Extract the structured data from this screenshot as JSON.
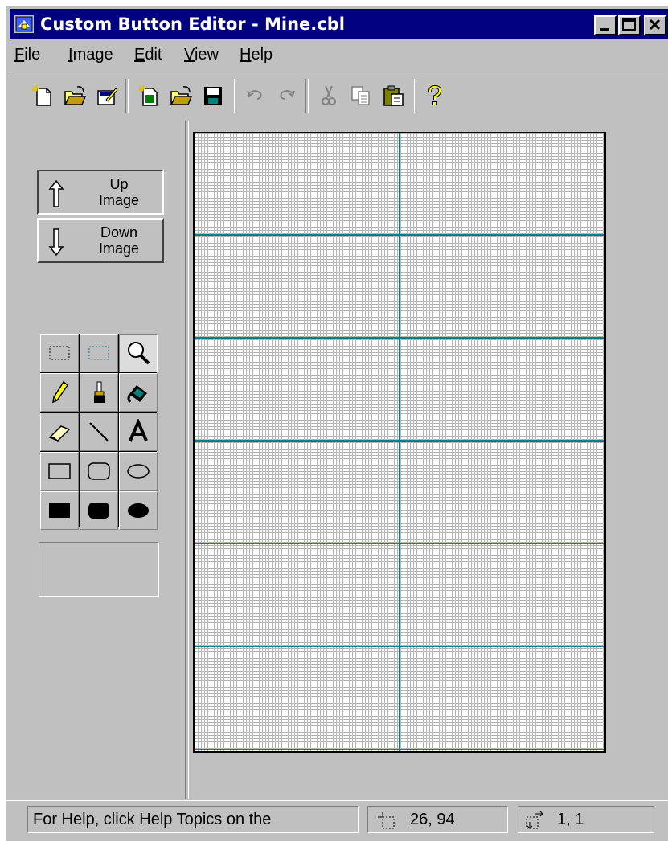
{
  "window": {
    "title": "Custom Button Editor - Mine.cbl",
    "title_bar_color": "#000080"
  },
  "menu": [
    {
      "label": "File",
      "accel": "F",
      "rest": "ile"
    },
    {
      "label": "Image",
      "accel": "I",
      "rest": "mage"
    },
    {
      "label": "Edit",
      "accel": "E",
      "rest": "dit"
    },
    {
      "label": "View",
      "accel": "V",
      "rest": "iew"
    },
    {
      "label": "Help",
      "accel": "H",
      "rest": "elp"
    }
  ],
  "toolbar_icons": [
    "new-library-icon",
    "open-library-icon",
    "edit-library-icon",
    "new-image-icon",
    "open-image-icon",
    "save-icon",
    "undo-icon",
    "redo-icon",
    "cut-icon",
    "copy-icon",
    "paste-icon",
    "help-icon"
  ],
  "image_buttons": {
    "up": {
      "line1": "Up",
      "line2": "Image",
      "selected": true
    },
    "down": {
      "line1": "Down",
      "line2": "Image",
      "selected": false
    }
  },
  "tools": [
    "select-rectangle",
    "select-color-region",
    "zoom",
    "pencil",
    "brush",
    "fill",
    "eraser",
    "line",
    "text",
    "rectangle",
    "rounded-rectangle",
    "ellipse",
    "filled-rectangle",
    "filled-rounded-rectangle",
    "filled-ellipse"
  ],
  "grid_line_color": "#008080",
  "status": {
    "help_text": "For Help, click Help Topics on the",
    "position": "26, 94",
    "size": "1, 1"
  }
}
